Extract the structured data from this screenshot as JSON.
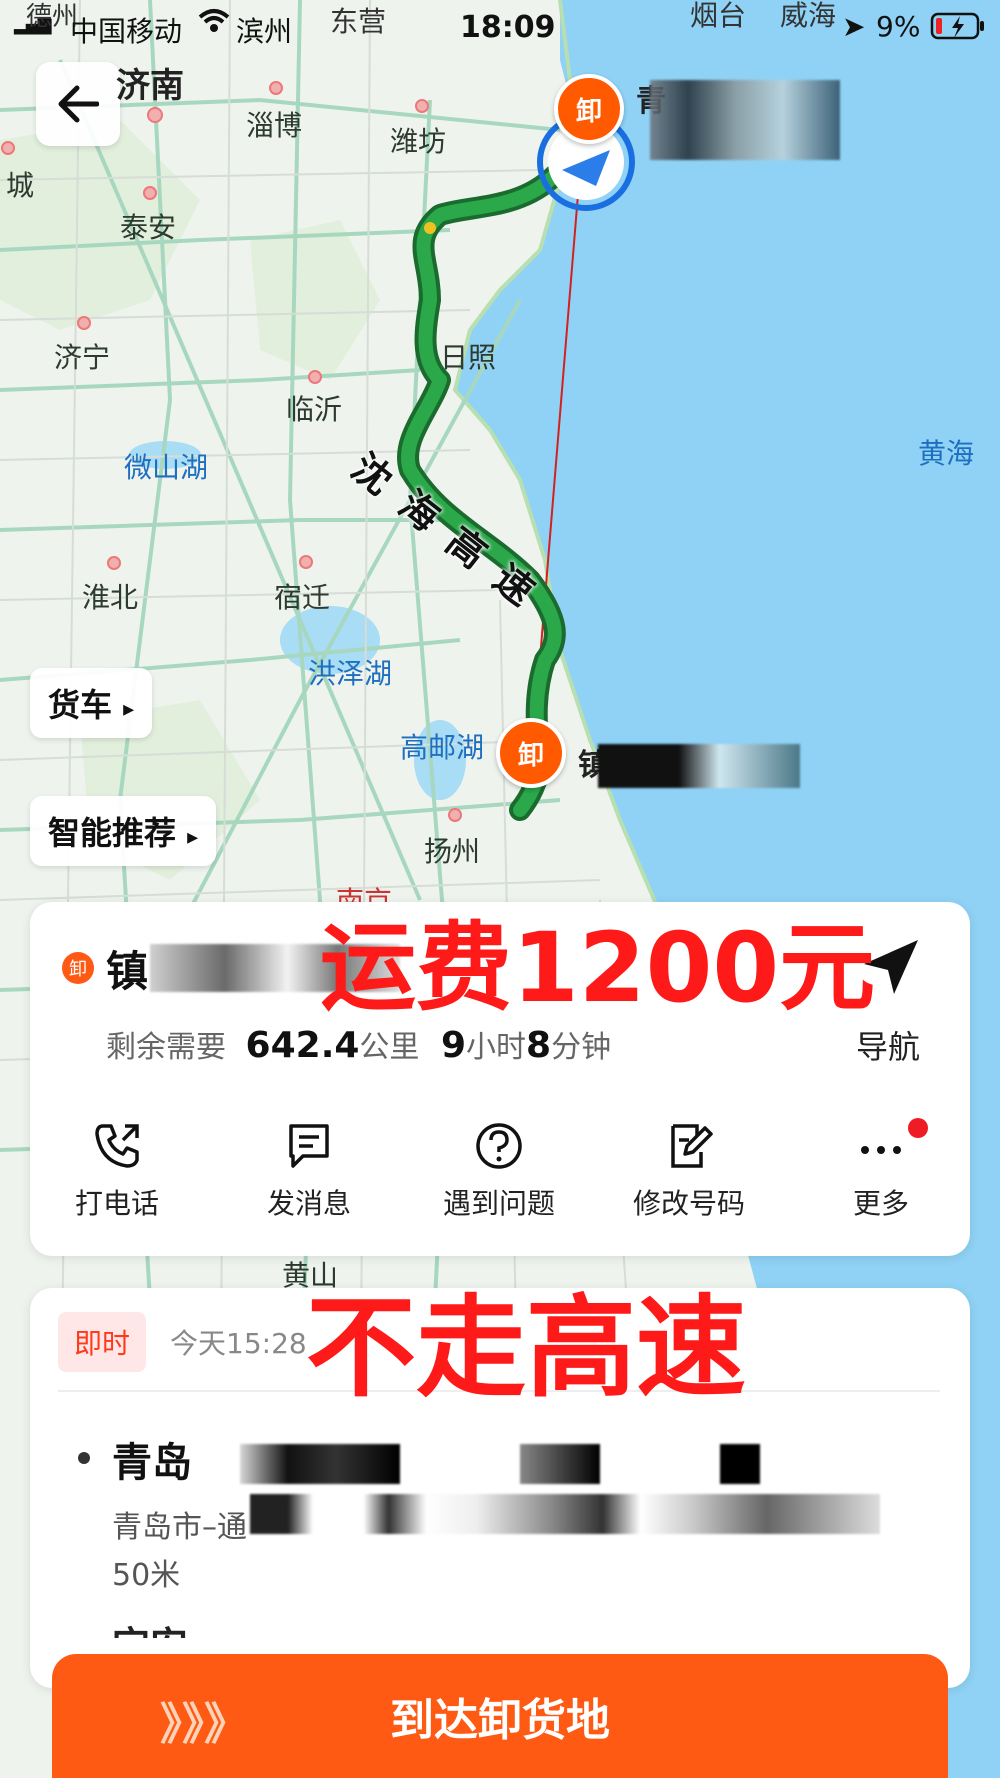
{
  "status_bar": {
    "top_left_city": "德州",
    "carrier": "中国移动",
    "network_city": "滨州",
    "top_city2": "东营",
    "time": "18:09",
    "top_city3": "烟台",
    "top_city4": "威海",
    "battery": "9%"
  },
  "map": {
    "cities": {
      "jinan": "济南",
      "zibo": "淄博",
      "weifang": "潍坊",
      "liaocheng_partial": "城",
      "taian": "泰安",
      "jining": "济宁",
      "linyi": "临沂",
      "rizhao": "日照",
      "huaibei": "淮北",
      "suqian": "宿迁",
      "yangzhou": "扬州",
      "nanjing_partial": "南京",
      "huangshan": "黄山",
      "qingdao_partial": "青",
      "zhenjiang_partial": "镇"
    },
    "lakes": {
      "weishan": "微山湖",
      "hongze": "洪泽湖",
      "gaoyou": "高邮湖"
    },
    "sea": "黄海",
    "route_label": "沈海高速",
    "marker_label": "卸"
  },
  "side_buttons": {
    "truck": "货车",
    "smart": "智能推荐"
  },
  "overlay_text": {
    "fare": "运费1200元",
    "no_highway": "不走高速"
  },
  "route_card": {
    "badge": "卸",
    "dest_prefix": "镇",
    "remaining_label": "剩余需要",
    "distance": "642.4",
    "distance_unit": "公里",
    "hours": "9",
    "hours_unit": "小时",
    "minutes": "8",
    "minutes_unit": "分钟",
    "nav_label": "导航",
    "actions": [
      "打电话",
      "发消息",
      "遇到问题",
      "修改号码",
      "更多"
    ]
  },
  "order_card": {
    "tag": "即时",
    "time": "今天15:28",
    "origin_name": "青岛",
    "origin_address": "青岛市–通",
    "origin_distance": "50米",
    "next_partial": "宝安"
  },
  "bottom_button": {
    "label": "到达卸货地",
    "chevrons": "》》》"
  },
  "colors": {
    "accent": "#ff5a14",
    "route": "#1f9a3a",
    "overlay": "#ff1a1a",
    "sea": "#8fd2f5"
  }
}
